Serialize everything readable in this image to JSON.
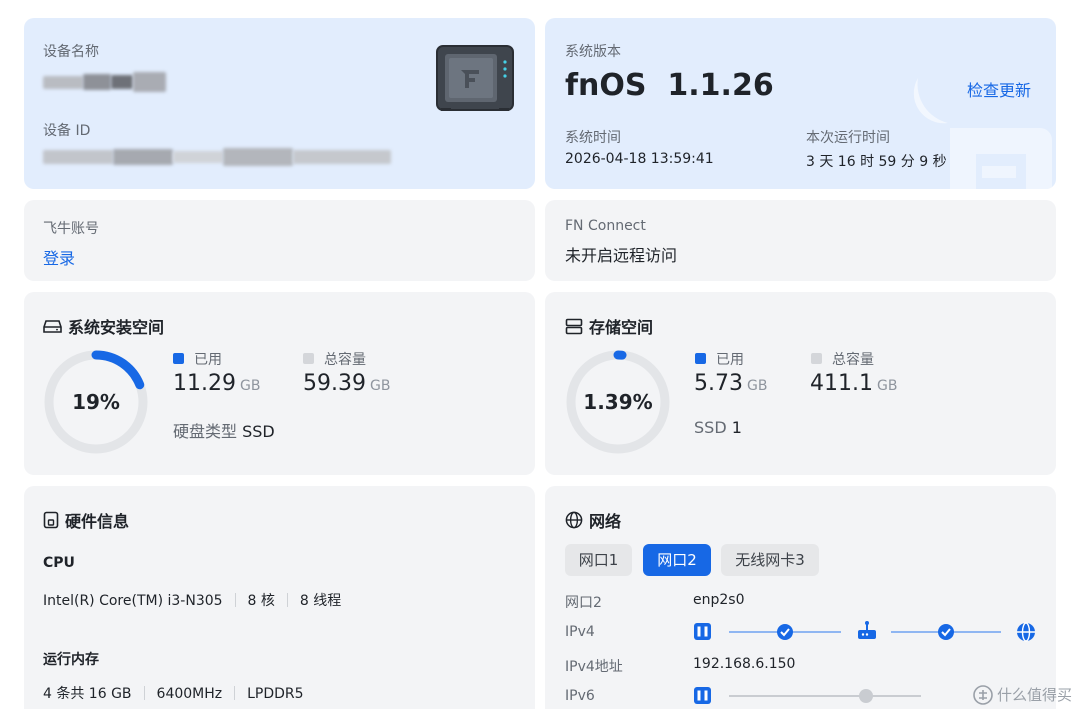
{
  "device": {
    "name_label": "设备名称",
    "id_label": "设备 ID"
  },
  "system": {
    "version_label": "系统版本",
    "version": "fnOS  1.1.26",
    "check_update": "检查更新",
    "time_label": "系统时间",
    "time_value": "2026-04-18 13:59:41",
    "uptime_label": "本次运行时间",
    "uptime_value": "3 天 16 时 59 分 9 秒"
  },
  "account": {
    "label": "飞牛账号",
    "login": "登录"
  },
  "fn_connect": {
    "label": "FN Connect",
    "status": "未开启远程访问"
  },
  "system_disk": {
    "title": "系统安装空间",
    "percent_text": "19%",
    "percent": 0.19,
    "used_label": "已用",
    "used_value": "11.29",
    "used_unit": "GB",
    "total_label": "总容量",
    "total_value": "59.39",
    "total_unit": "GB",
    "disk_type_label": "硬盘类型",
    "disk_type_value": "SSD"
  },
  "storage": {
    "title": "存储空间",
    "percent_text": "1.39%",
    "percent": 0.0139,
    "used_label": "已用",
    "used_value": "5.73",
    "used_unit": "GB",
    "total_label": "总容量",
    "total_value": "411.1",
    "total_unit": "GB",
    "ssd_label": "SSD",
    "ssd_count": "1"
  },
  "hardware": {
    "title": "硬件信息",
    "cpu_label": "CPU",
    "cpu_model": "Intel(R) Core(TM) i3-N305",
    "cpu_cores": "8 核",
    "cpu_threads": "8 线程",
    "mem_label": "运行内存",
    "mem_count": "4 条共 16 GB",
    "mem_speed": "6400MHz",
    "mem_type": "LPDDR5"
  },
  "network": {
    "title": "网络",
    "tabs": [
      "网口1",
      "网口2",
      "无线网卡3"
    ],
    "active_tab": 1,
    "iface_label": "网口2",
    "iface_value": "enp2s0",
    "ipv4_label": "IPv4",
    "ipv4_addr_label": "IPv4地址",
    "ipv4_addr_value": "192.168.6.150",
    "ipv6_label": "IPv6"
  },
  "watermark": "什么值得买",
  "colors": {
    "accent": "#1768e5",
    "ring_track": "#e3e5e8",
    "card_blue": "#e2edfd",
    "card_gray": "#f3f4f6"
  }
}
